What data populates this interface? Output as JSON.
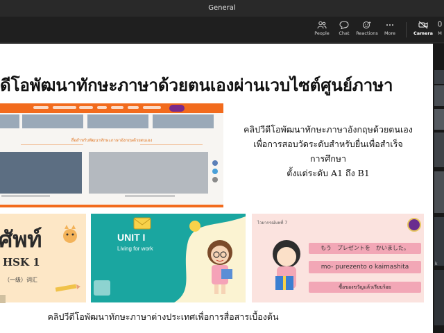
{
  "window": {
    "title": "General"
  },
  "toolbar": {
    "people": "People",
    "chat": "Chat",
    "reactions": "Reactions",
    "more": "More",
    "camera": "Camera",
    "mic_partial": "M"
  },
  "slide": {
    "title": "ดีโอพัฒนาทักษะภาษาด้วยตนเองผ่านเวบไซต์ศูนย์ภาษา",
    "website": {
      "section_heading": "สื่อสำหรับพัฒนาทักษะภาษาอังกฤษด้วยตนเอง"
    },
    "description": [
      "คลิปวีดีโอพัฒนาทักษะภาษาอังกฤษด้วยตนเอง",
      "เพื่อการสอบวัดระดับสำหรับยื่นเพื่อสำเร็จ",
      "การศึกษา",
      "ตั้งแต่ระดับ A1 ถึง B1"
    ],
    "thumbnails": {
      "hsk": {
        "big_text": "ศัพท์",
        "sub_text": "HSK 1",
        "tag": "（一级）词汇"
      },
      "unit": {
        "title": "UNIT I",
        "subtitle": "Living for work"
      },
      "japanese": {
        "header": "ไวยากรณ์บทที่ 7",
        "line1": "もう　プレゼントを　かいました。",
        "line2": "mo- purezento o kaimashita",
        "line3": "ซื้อของขวัญแล้วเรียบร้อย"
      }
    },
    "bottom_caption": "คลิปวีดีโอพัฒนาทักษะภาษาต่างประเทศเพื่อการสื่อสารเบื้องต้น"
  },
  "colors": {
    "site_orange": "#f26b1d",
    "teal": "#1aa6a0",
    "pink_box": "#f2a7b6",
    "logo_purple": "#6a2c8f"
  },
  "participants_rail": {
    "partial_label": "k"
  }
}
